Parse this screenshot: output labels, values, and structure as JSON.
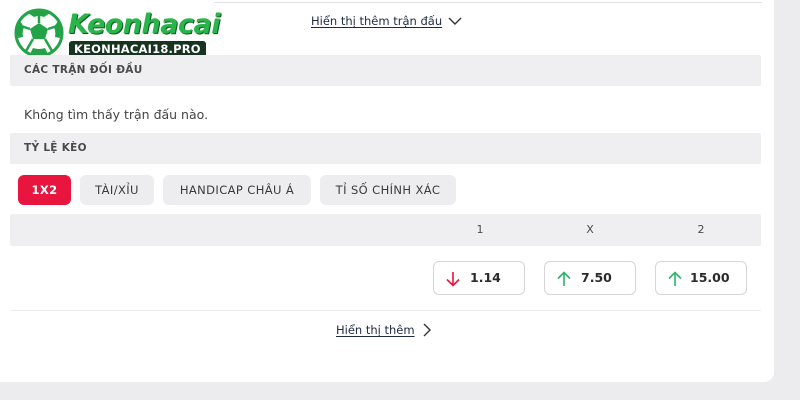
{
  "logo": {
    "title": "Keonhacai",
    "url": "KEONHACAI18.PRO",
    "colors": {
      "title": "#2ab54a",
      "badge": "#16341f"
    }
  },
  "more_matches_link": "Hiển thị thêm trận đấu",
  "head_to_head": {
    "title": "CÁC TRẬN ĐỐI ĐẦU",
    "empty_text": "Không tìm thấy trận đấu nào."
  },
  "odds": {
    "title": "TỶ LỆ KÈO",
    "tabs": [
      {
        "label": "1X2",
        "active": true
      },
      {
        "label": "TÀI/XỈU",
        "active": false
      },
      {
        "label": "HANDICAP CHÂU Á",
        "active": false
      },
      {
        "label": "TỈ SỐ CHÍNH XÁC",
        "active": false
      }
    ],
    "columns": [
      "1",
      "X",
      "2"
    ],
    "values": [
      {
        "value": "1.14",
        "trend": "down",
        "icon": "arrow-down-icon"
      },
      {
        "value": "7.50",
        "trend": "up",
        "icon": "arrow-up-icon"
      },
      {
        "value": "15.00",
        "trend": "up",
        "icon": "arrow-up-icon"
      }
    ],
    "colors": {
      "down": "#e8153f",
      "up": "#2db36a",
      "active_tab": "#e8153f"
    }
  },
  "show_more": "Hiển thị thêm"
}
